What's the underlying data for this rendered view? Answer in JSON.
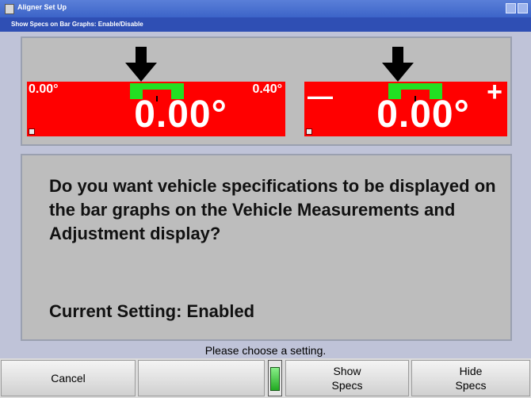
{
  "window": {
    "title": "Aligner Set Up",
    "subtitle": "Show Specs on Bar Graphs: Enable/Disable"
  },
  "gauges": {
    "left": {
      "low_label": "0.00°",
      "high_label": "0.40°",
      "value": "0.00°",
      "icon": "down-arrow-icon"
    },
    "right": {
      "minus_label": "—",
      "plus_label": "+",
      "value": "0.00°",
      "icon": "down-arrow-icon"
    }
  },
  "question": "Do you want vehicle specifications to be displayed on the bar graphs on the Vehicle Measurements and Adjustment display?",
  "current_setting": "Current Setting: Enabled",
  "status_text": "Please choose a setting.",
  "buttons": {
    "cancel": "Cancel",
    "blank": "",
    "show_specs_line1": "Show",
    "show_specs_line2": "Specs",
    "hide_specs_line1": "Hide",
    "hide_specs_line2": "Specs"
  },
  "colors": {
    "bar": "#ff0000",
    "in_spec": "#22e022"
  }
}
